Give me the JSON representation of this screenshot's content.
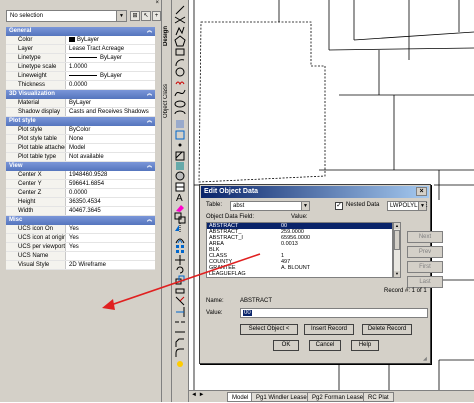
{
  "properties": {
    "selection": "No selection",
    "vertical_tabs": [
      "Design",
      "Object Class"
    ],
    "sections": [
      {
        "title": "General",
        "rows": [
          {
            "label": "Color",
            "value": "ByLayer",
            "kind": "color"
          },
          {
            "label": "Layer",
            "value": "Lease Tract Acreage"
          },
          {
            "label": "Linetype",
            "value": "ByLayer",
            "kind": "line"
          },
          {
            "label": "Linetype scale",
            "value": "1.0000"
          },
          {
            "label": "Lineweight",
            "value": "ByLayer",
            "kind": "line"
          },
          {
            "label": "Thickness",
            "value": "0.0000"
          }
        ]
      },
      {
        "title": "3D Visualization",
        "rows": [
          {
            "label": "Material",
            "value": "ByLayer"
          },
          {
            "label": "Shadow display",
            "value": "Casts and Receives Shadows"
          }
        ]
      },
      {
        "title": "Plot style",
        "rows": [
          {
            "label": "Plot style",
            "value": "ByColor"
          },
          {
            "label": "Plot style table",
            "value": "None"
          },
          {
            "label": "Plot table attached to",
            "value": "Model"
          },
          {
            "label": "Plot table type",
            "value": "Not available"
          }
        ]
      },
      {
        "title": "View",
        "rows": [
          {
            "label": "Center X",
            "value": "1948460.9528"
          },
          {
            "label": "Center Y",
            "value": "596641.6854"
          },
          {
            "label": "Center Z",
            "value": "0.0000"
          },
          {
            "label": "Height",
            "value": "36350.4534"
          },
          {
            "label": "Width",
            "value": "40467.3645"
          }
        ]
      },
      {
        "title": "Misc",
        "rows": [
          {
            "label": "UCS icon On",
            "value": "Yes"
          },
          {
            "label": "UCS icon at origin",
            "value": "Yes"
          },
          {
            "label": "UCS per viewport",
            "value": "Yes"
          },
          {
            "label": "UCS Name",
            "value": ""
          },
          {
            "label": "Visual Style",
            "value": "2D Wireframe"
          }
        ]
      }
    ]
  },
  "layout_tabs": [
    "Model",
    "Pg1 Windler Lease",
    "Pg2 Forman Lease",
    "RC Plat"
  ],
  "dialog": {
    "title": "Edit Object Data",
    "close": "×",
    "table_label": "Table:",
    "table_value": "abst",
    "nested_label": "Nested Data",
    "nested_checked": "✓",
    "type_value": "LWPOLYLINE",
    "col_field": "Object Data Field:",
    "col_value": "Value:",
    "rows": [
      {
        "field": "ABSTRACT",
        "value": "00"
      },
      {
        "field": "ABSTRACT_",
        "value": "259.0000"
      },
      {
        "field": "ABSTRACT_I",
        "value": "65956.0000"
      },
      {
        "field": "AREA",
        "value": "0.0013"
      },
      {
        "field": "BLK",
        "value": ""
      },
      {
        "field": "CLASS",
        "value": "1"
      },
      {
        "field": "COUNTY",
        "value": "497"
      },
      {
        "field": "GRANTEE",
        "value": "A. BLOUNT"
      },
      {
        "field": "LEAGUEFLAG",
        "value": ""
      }
    ],
    "right_buttons": [
      "Next",
      "Prev",
      "First",
      "Last"
    ],
    "record_label": "Record #: 1 of 1",
    "name_label": "Name:",
    "name_value": "ABSTRACT",
    "value_label": "Value:",
    "value_input": "00",
    "action_buttons": [
      "Select Object <",
      "Insert Record",
      "Delete Record"
    ],
    "bottom_buttons": [
      "OK",
      "Cancel",
      "Help"
    ]
  },
  "colors": {
    "title_bar": "#0a246a",
    "section_header": "#6684cc",
    "arrow": "#e02020"
  }
}
